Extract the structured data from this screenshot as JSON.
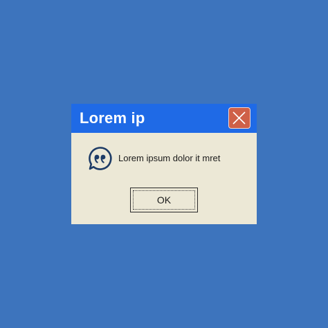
{
  "dialog": {
    "title": "Lorem ip",
    "message": "Lorem ipsum dolor it mret",
    "ok_label": "OK",
    "message_icon": "quote-bubble-icon",
    "close_icon": "close-icon"
  },
  "colors": {
    "background": "#3d74bd",
    "titlebar": "#1f6ae6",
    "dialog_body": "#ece8d6",
    "close_button": "#cf6048",
    "icon": "#1d3b66"
  }
}
